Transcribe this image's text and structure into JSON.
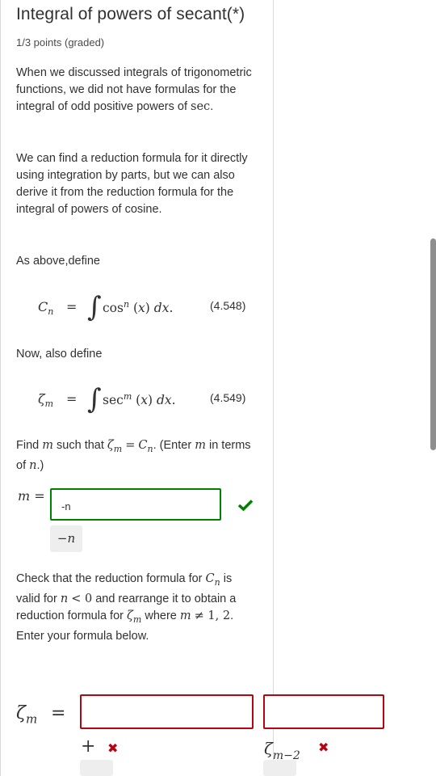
{
  "problem": {
    "title": "Integral of powers of secant(*)",
    "points": "1/3 points (graded)",
    "intro_1": "When we discussed integrals of trigonometric functions, we did not have formulas for the integral of odd positive powers of",
    "intro_sec": "sec",
    "intro_end": ".",
    "intro_2": "We can find a reduction formula for it directly using integration by parts, but we can also derive it from the reduction formula for the integral of powers of cosine.",
    "define_1": "As above,define",
    "define_2": "Now, also define",
    "eq1_number": "(4.548)",
    "eq2_number": "(4.549)",
    "find_text_a": "Find",
    "find_text_b": "such that",
    "find_text_c": ". (Enter",
    "find_text_d": "in terms of",
    "find_text_e": ".)",
    "m_answer": "-n",
    "m_preview": "−n",
    "check_text_a": "Check that the reduction formula for",
    "check_text_b": "is valid for",
    "check_text_c": "and rearrange it to obtain a reduction formula for",
    "check_text_d": "where",
    "check_text_e": ". Enter your formula below.",
    "answer_1": "",
    "answer_2": ""
  },
  "colors": {
    "correct": "#008100",
    "incorrect": "#b20610"
  }
}
